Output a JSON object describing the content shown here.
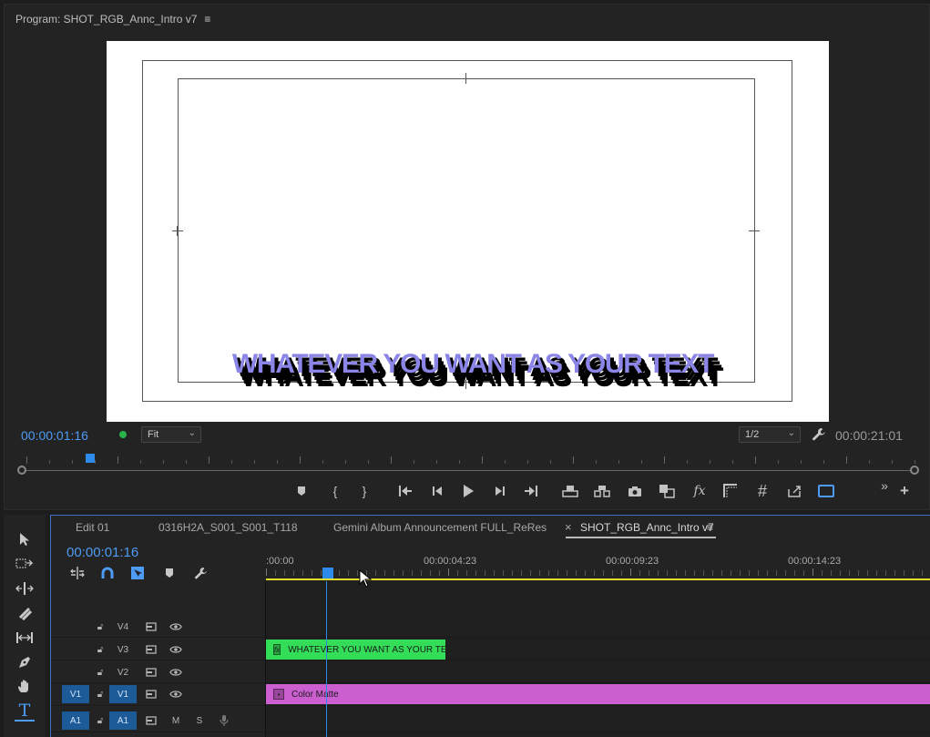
{
  "program_monitor": {
    "title": "Program: SHOT_RGB_Annc_Intro v7",
    "menu_icon": "hamburger-menu-icon",
    "overlay_text": "WHATEVER YOU WANT AS YOUR TEXT",
    "current_time": "00:00:01:16",
    "zoom": "Fit",
    "resolution": "1/2",
    "duration": "00:00:21:01",
    "status_color": "#29b34a"
  },
  "transport": [
    "add-marker-icon",
    "mark-in-icon",
    "mark-out-icon",
    "go-to-in-icon",
    "step-back-icon",
    "play-icon",
    "step-forward-icon",
    "go-to-out-icon",
    "lift-icon",
    "extract-icon",
    "export-frame-icon",
    "comparison-view-icon",
    "fx-icon",
    "safe-margins-icon",
    "grid-icon",
    "proxy-icon",
    "vr-video-icon",
    "overflow-icon",
    "add-button-icon"
  ],
  "tools": [
    "selection-tool-icon",
    "track-select-tool-icon",
    "ripple-edit-tool-icon",
    "razor-tool-icon",
    "slip-tool-icon",
    "pen-tool-icon",
    "hand-tool-icon",
    "type-tool-icon"
  ],
  "timeline": {
    "tabs": [
      {
        "label": "Edit 01"
      },
      {
        "label": "0316H2A_S001_S001_T118"
      },
      {
        "label": "Gemini Album Announcement FULL_ReRes"
      },
      {
        "label": "SHOT_RGB_Annc_Intro v7"
      }
    ],
    "active_tab_close": "×",
    "current_time": "00:00:01:16",
    "ruler_labels": [
      ":00:00",
      "00:00:04:23",
      "00:00:09:23",
      "00:00:14:23"
    ],
    "tracks": [
      {
        "name": "V4",
        "lock": "lock-icon",
        "sync": "sync-lock-icon",
        "eye": "eye-icon"
      },
      {
        "name": "V3"
      },
      {
        "name": "V2"
      },
      {
        "name": "V1",
        "source": "V1"
      },
      {
        "name": "A1",
        "source": "A1",
        "mute": "M",
        "solo": "S",
        "mic": "mic-icon"
      }
    ],
    "clips": {
      "text_clip": "WHATEVER YOU WANT AS YOUR TEXT",
      "matte_clip": "Color Matte",
      "fx_label": "fx"
    },
    "colors": {
      "accent": "#2d8ceb",
      "text_clip": "#33dd57",
      "matte_clip": "#cc5fcf",
      "work_area": "#e2dc2a",
      "overlay_text": "#8a85e6"
    }
  }
}
